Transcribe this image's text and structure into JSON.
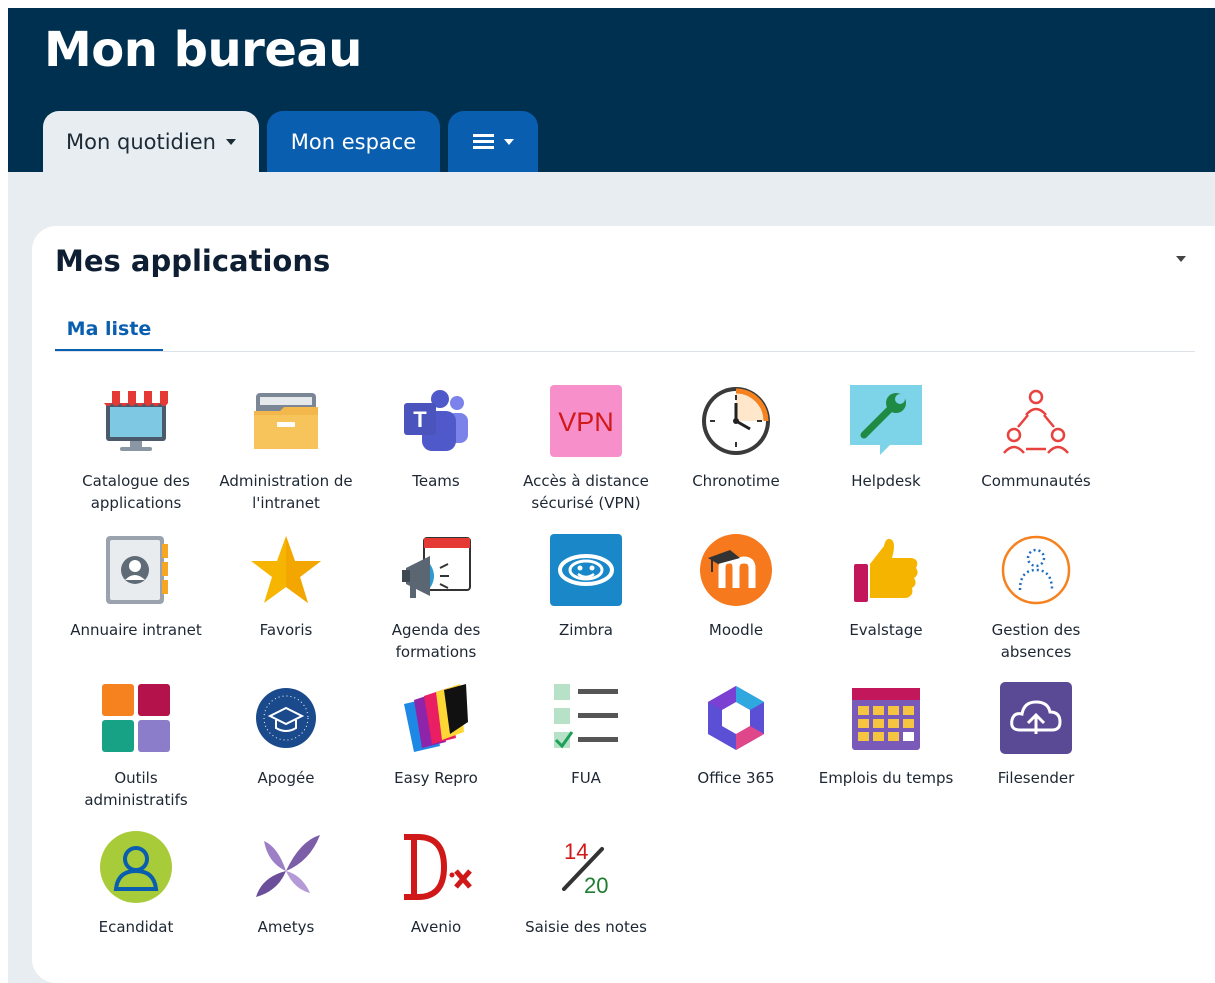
{
  "header": {
    "title": "Mon bureau",
    "tabs": [
      {
        "label": "Mon quotidien",
        "active": true,
        "icon": "chevron-down-icon"
      },
      {
        "label": "Mon espace",
        "active": false
      },
      {
        "label": "",
        "icon": "hamburger-menu-icon"
      }
    ]
  },
  "card": {
    "title": "Mes applications",
    "subtab": "Ma liste"
  },
  "apps": [
    {
      "label": "Catalogue des applications",
      "icon": "store-monitor-icon"
    },
    {
      "label": "Administration de l'intranet",
      "icon": "folder-icon"
    },
    {
      "label": "Teams",
      "icon": "teams-icon"
    },
    {
      "label": "Accès à distance sécurisé (VPN)",
      "icon": "vpn-icon",
      "icon_text": "VPN"
    },
    {
      "label": "Chronotime",
      "icon": "clock-icon"
    },
    {
      "label": "Helpdesk",
      "icon": "wrench-chat-icon"
    },
    {
      "label": "Communautés",
      "icon": "community-icon"
    },
    {
      "label": "Annuaire intranet",
      "icon": "address-book-icon"
    },
    {
      "label": "Favoris",
      "icon": "star-icon"
    },
    {
      "label": "Agenda des formations",
      "icon": "megaphone-calendar-icon"
    },
    {
      "label": "Zimbra",
      "icon": "zimbra-icon"
    },
    {
      "label": "Moodle",
      "icon": "moodle-icon"
    },
    {
      "label": "Evalstage",
      "icon": "thumbs-up-icon"
    },
    {
      "label": "Gestion des absences",
      "icon": "absent-person-icon"
    },
    {
      "label": "Outils administratifs",
      "icon": "tiles-icon"
    },
    {
      "label": "Apogée",
      "icon": "graduation-cap-icon"
    },
    {
      "label": "Easy Repro",
      "icon": "books-icon"
    },
    {
      "label": "FUA",
      "icon": "checklist-icon"
    },
    {
      "label": "Office 365",
      "icon": "office-365-icon"
    },
    {
      "label": "Emplois du temps",
      "icon": "calendar-icon"
    },
    {
      "label": "Filesender",
      "icon": "cloud-upload-icon"
    },
    {
      "label": "Ecandidat",
      "icon": "user-circle-icon"
    },
    {
      "label": "Ametys",
      "icon": "ametys-icon"
    },
    {
      "label": "Avenio",
      "icon": "avenio-icon",
      "icon_text": "Dx"
    },
    {
      "label": "Saisie des notes",
      "icon": "grade-fraction-icon",
      "icon_text_num": "14",
      "icon_text_den": "20",
      "highlighted": true
    }
  ],
  "colors": {
    "header_bg": "#00304f",
    "tab_blue": "#0a5eb0",
    "highlight": "#fff200"
  }
}
